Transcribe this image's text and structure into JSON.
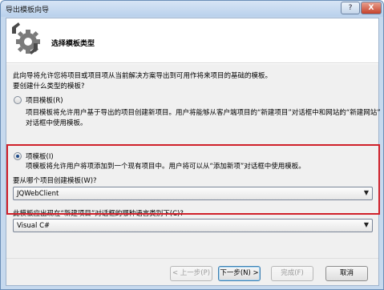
{
  "window": {
    "title": "导出模板向导",
    "help": "?",
    "close": "X"
  },
  "header": {
    "title": "选择模板类型",
    "icon": "gear-arrow-icon"
  },
  "intro": {
    "description": "此向导将允许您将项目或项目项从当前解决方案导出到可用作将来项目的基础的模板。",
    "question": "要创建什么类型的模板?"
  },
  "options": {
    "project_template": {
      "label": "项目模板(R)",
      "checked": false,
      "desc_line1": "项目模板将允许用户基于导出的项目创建新项目。用户将能够从客户端项目的“新建项目”对话框中和网站的“新建网站”",
      "desc_line2": "对话框中使用模板。"
    },
    "item_template": {
      "label": "项模板(I)",
      "checked": true,
      "desc": "项模板将允许用户将项添加到一个现有项目中。用户将可以从“添加新项”对话框中使用模板。"
    }
  },
  "project_select": {
    "label": "要从哪个项目创建模板(W)?",
    "value": "JQWebClient"
  },
  "language_select": {
    "label": "此模板应出现在“新建项目”对话框的哪种语言类别下(C)?",
    "value": "Visual C#"
  },
  "buttons": {
    "back": "< 上一步(P)",
    "next": "下一步(N) >",
    "finish": "完成(F)",
    "cancel": "取消"
  }
}
